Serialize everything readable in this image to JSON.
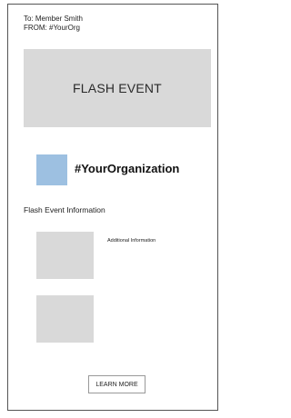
{
  "header": {
    "to_line": "To: Member Smith",
    "from_line": "FROM: #YourOrg"
  },
  "hero": {
    "title": "FLASH EVENT"
  },
  "organization": {
    "name": "#YourOrganization",
    "logo_color": "#9dc0e1"
  },
  "section": {
    "title": "Flash Event Information",
    "additional_info": "Additional Information"
  },
  "cta": {
    "label": "LEARN MORE"
  },
  "colors": {
    "placeholder": "#d9d9d9",
    "border": "#555555"
  }
}
